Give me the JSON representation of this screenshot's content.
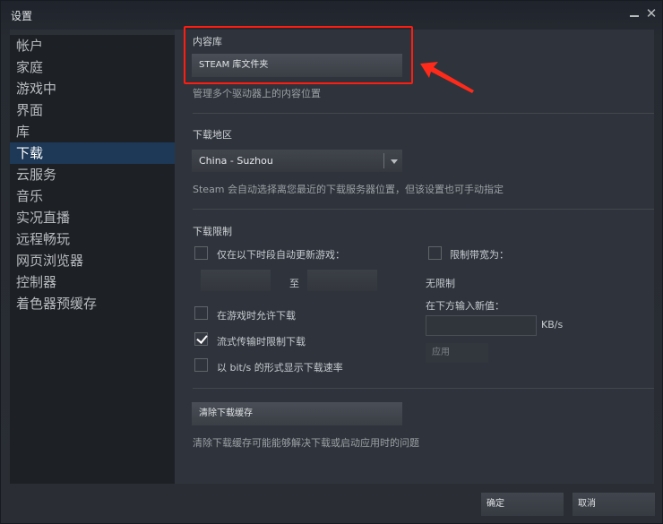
{
  "window": {
    "title": "设置",
    "minimize_label": "minimize",
    "close_glyph": "✕"
  },
  "sidebar": {
    "items": [
      {
        "label": "帐户"
      },
      {
        "label": "家庭"
      },
      {
        "label": "游戏中"
      },
      {
        "label": "界面"
      },
      {
        "label": "库"
      },
      {
        "label": "下载",
        "active": true
      },
      {
        "label": "云服务"
      },
      {
        "label": "音乐"
      },
      {
        "label": "实况直播"
      },
      {
        "label": "远程畅玩"
      },
      {
        "label": "网页浏览器"
      },
      {
        "label": "控制器"
      },
      {
        "label": "着色器预缓存"
      }
    ]
  },
  "content_library": {
    "heading": "内容库",
    "button_label": "STEAM 库文件夹",
    "description": "管理多个驱动器上的内容位置"
  },
  "download_region": {
    "heading": "下载地区",
    "selected": "China - Suzhou",
    "description": "Steam 会自动选择离您最近的下载服务器位置，但该设置也可手动指定"
  },
  "download_limits": {
    "heading": "下载限制",
    "auto_update_window": {
      "label": "仅在以下时段自动更新游戏：",
      "checked": false,
      "from_value": "",
      "to_separator": "至",
      "to_value": ""
    },
    "allow_while_playing": {
      "label": "在游戏时允许下载",
      "checked": false
    },
    "throttle_while_streaming": {
      "label": "流式传输时限制下载",
      "checked": true
    },
    "show_bits": {
      "label": "以 bit/s 的形式显示下载速率",
      "checked": false
    },
    "limit_bandwidth": {
      "label": "限制带宽为：",
      "checked": false
    },
    "current_limit": "无限制",
    "enter_new_value": "在下方输入新值：",
    "kbs_value": "",
    "unit": "KB/s",
    "apply_label": "应用"
  },
  "download_cache": {
    "button_label": "清除下载缓存",
    "description": "清除下载缓存可能能够解决下载或启动应用时的问题"
  },
  "footer": {
    "ok_label": "确定",
    "cancel_label": "取消"
  },
  "annotation": {
    "highlight_color": "#ff1c10"
  }
}
